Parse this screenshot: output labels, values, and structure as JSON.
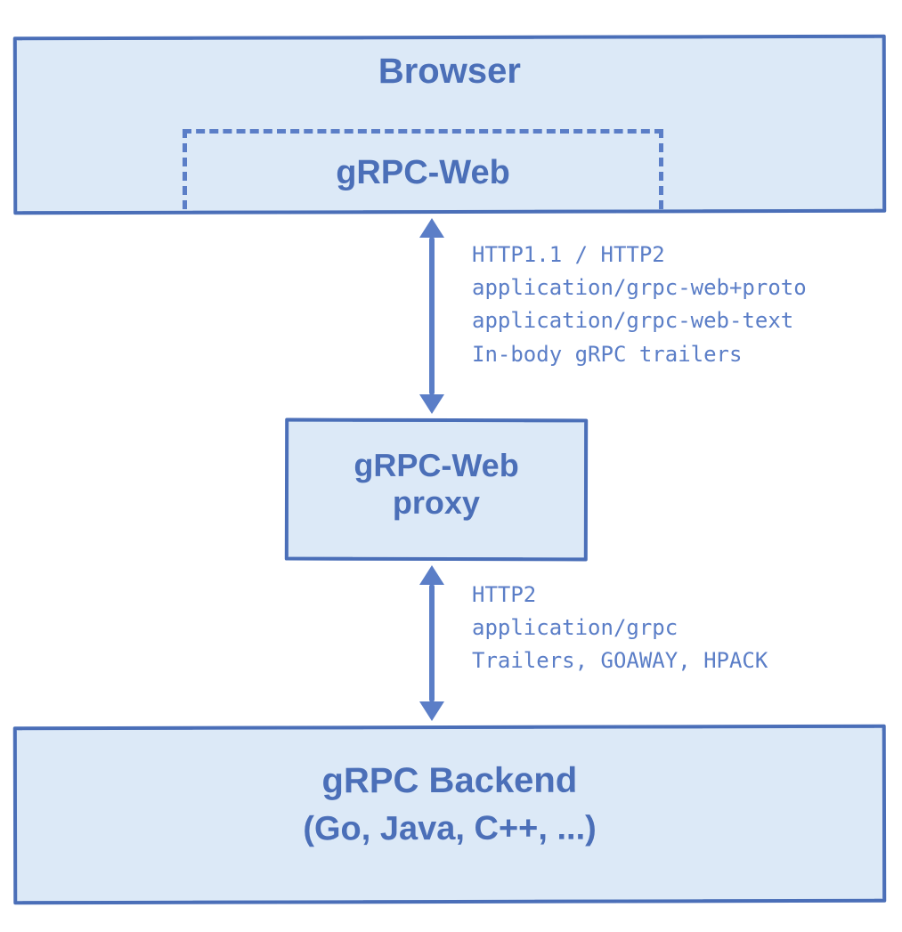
{
  "browser": {
    "title": "Browser",
    "inner_label": "gRPC-Web"
  },
  "proxy": {
    "line1": "gRPC-Web",
    "line2": "proxy"
  },
  "backend": {
    "line1": "gRPC Backend",
    "line2": "(Go, Java, C++, ...)"
  },
  "arrow1_annotation": {
    "l1": "HTTP1.1 / HTTP2",
    "l2": "application/grpc-web+proto",
    "l3": "application/grpc-web-text",
    "l4": "In-body gRPC trailers"
  },
  "arrow2_annotation": {
    "l1": "HTTP2",
    "l2": "application/grpc",
    "l3": "Trailers, GOAWAY, HPACK"
  }
}
